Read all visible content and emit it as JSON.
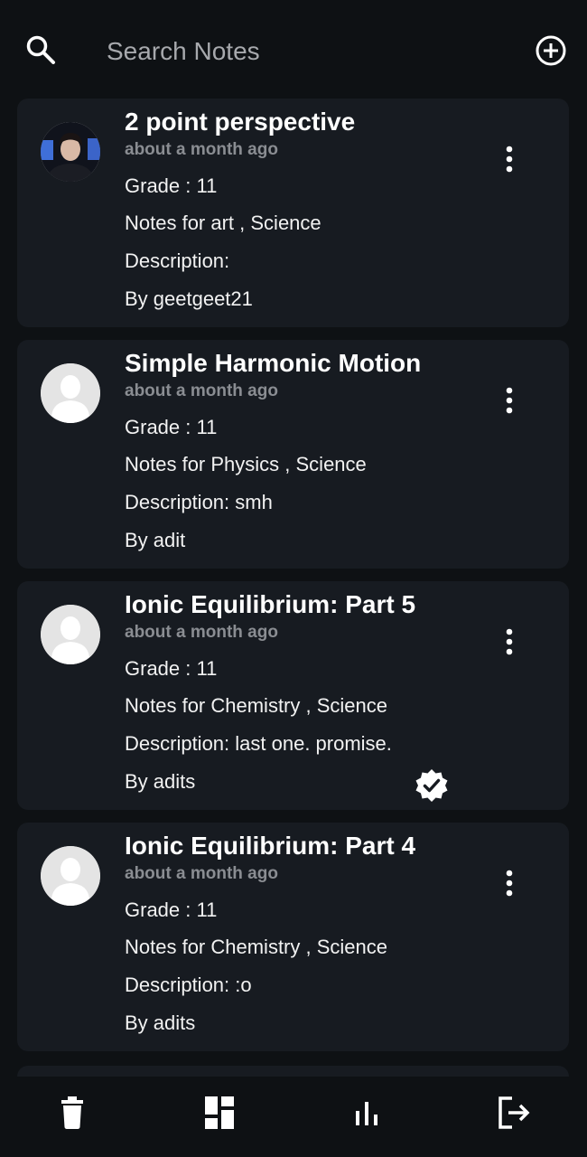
{
  "search": {
    "placeholder": "Search Notes"
  },
  "notes": [
    {
      "title": "2 point perspective",
      "time": "about a month ago",
      "grade": "Grade : 11",
      "subjects": "Notes for art , Science",
      "description": "Description:",
      "author": "By geetgeet21",
      "avatar": "photo-avatar",
      "verified": false
    },
    {
      "title": "Simple Harmonic Motion",
      "time": "about a month ago",
      "grade": "Grade : 11",
      "subjects": "Notes for Physics , Science",
      "description": "Description: smh",
      "author": "By adit",
      "avatar": "default-avatar",
      "verified": false
    },
    {
      "title": "Ionic Equilibrium: Part 5",
      "time": "about a month ago",
      "grade": "Grade : 11",
      "subjects": "Notes for Chemistry , Science",
      "description": "Description: last one. promise.",
      "author": "By adits",
      "avatar": "default-avatar",
      "verified": true
    },
    {
      "title": "Ionic Equilibrium: Part 4",
      "time": "about a month ago",
      "grade": "Grade : 11",
      "subjects": "Notes for Chemistry  , Science",
      "description": "Description: :o",
      "author": "By adits",
      "avatar": "default-avatar",
      "verified": false
    }
  ],
  "bottom_nav": [
    "delete-icon",
    "dashboard-icon",
    "stats-icon",
    "logout-icon"
  ],
  "colors": {
    "background": "#0e1114",
    "card": "#171b21",
    "muted": "#8a8d92"
  }
}
